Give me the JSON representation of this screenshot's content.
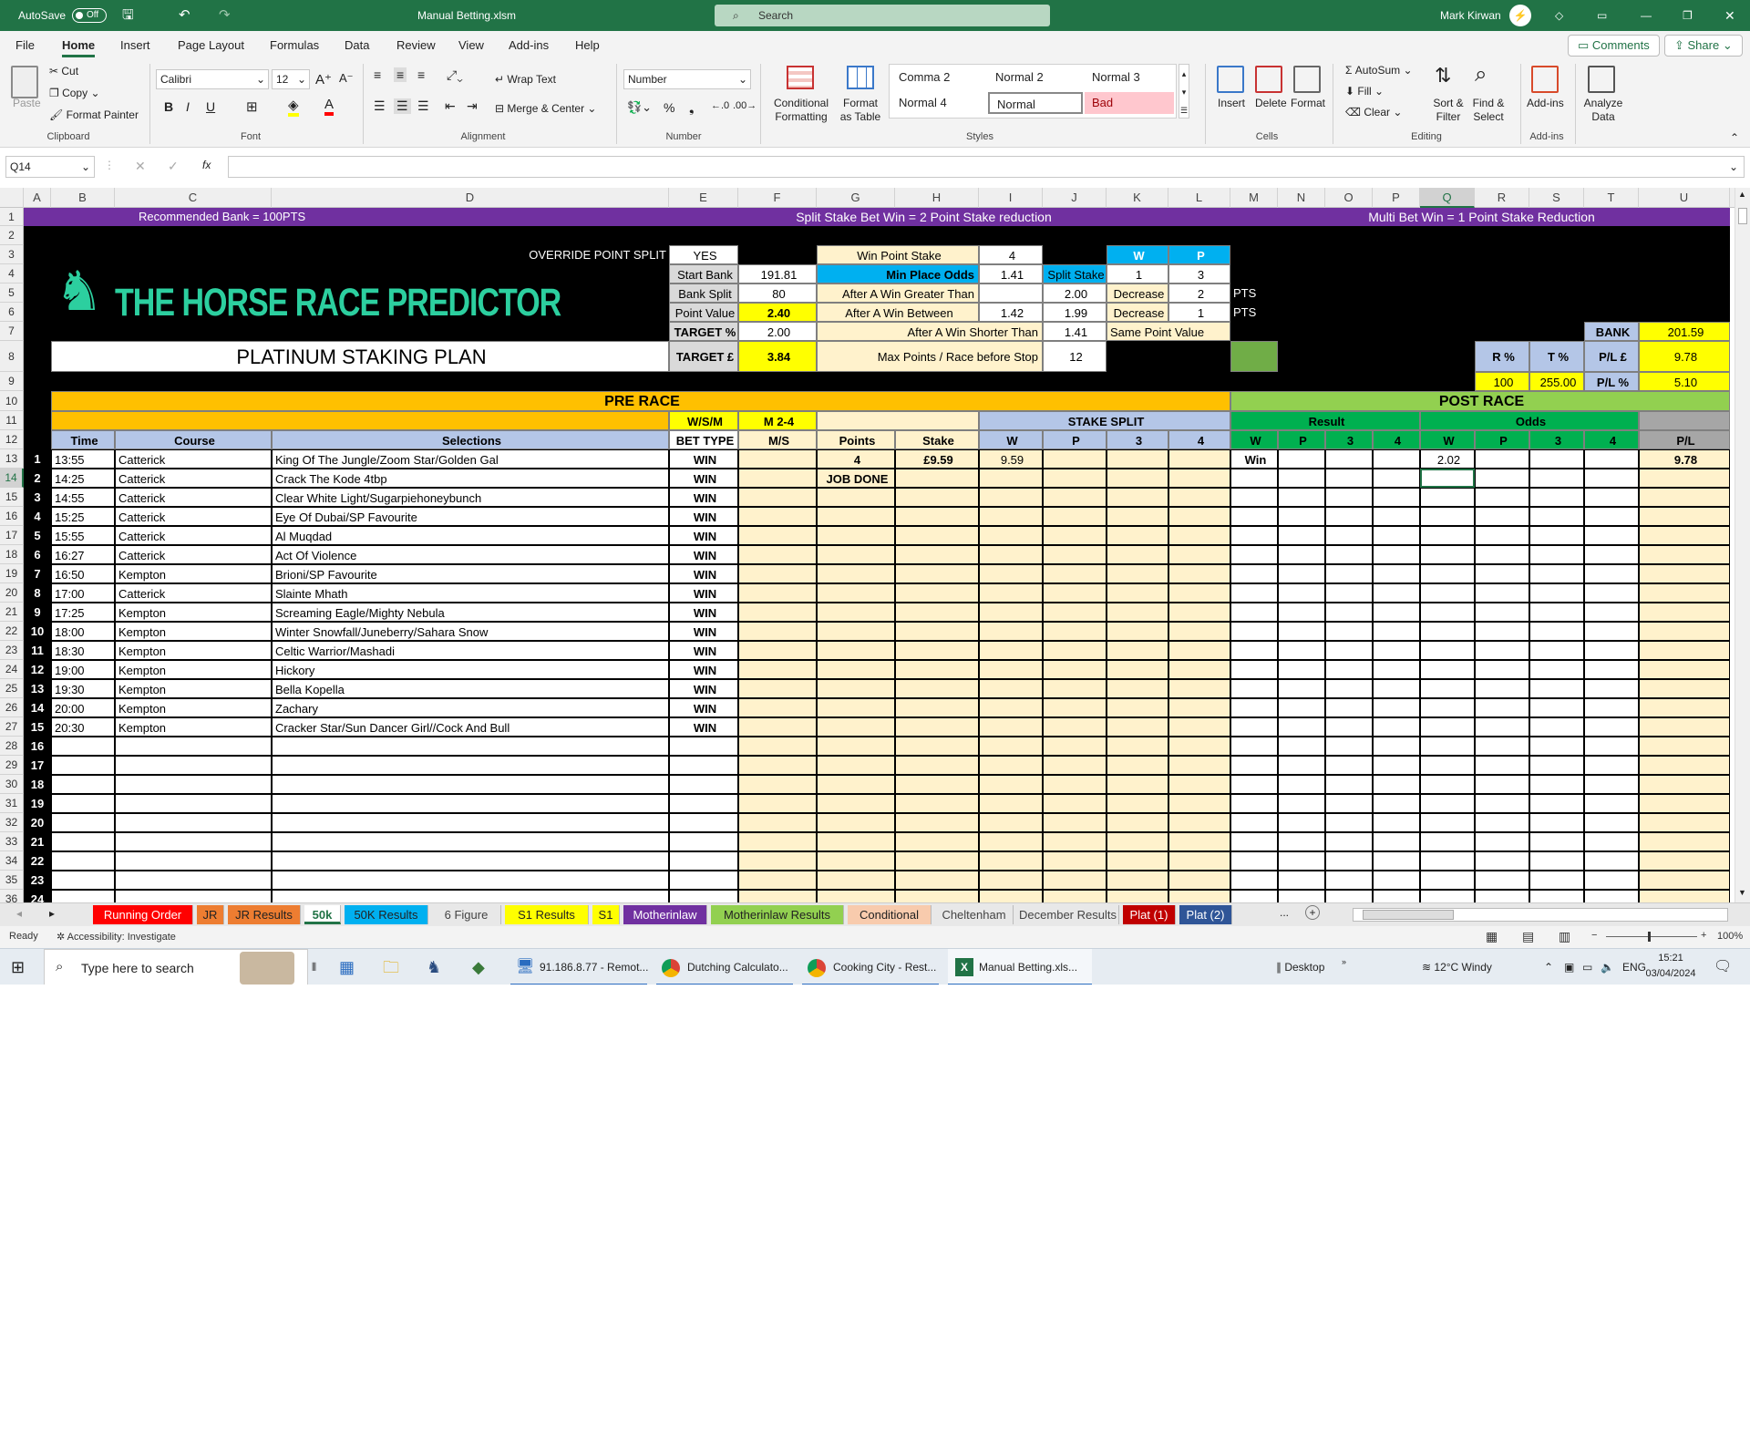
{
  "titlebar": {
    "autosave": "AutoSave",
    "toggle": "Off",
    "file": "Manual Betting.xlsm",
    "search": "Search",
    "user": "Mark Kirwan"
  },
  "menu": {
    "items": [
      "File",
      "Home",
      "Insert",
      "Page Layout",
      "Formulas",
      "Data",
      "Review",
      "View",
      "Add-ins",
      "Help"
    ],
    "comments": "Comments",
    "share": "Share"
  },
  "ribbon": {
    "clipboard": {
      "paste": "Paste",
      "cut": "Cut",
      "copy": "Copy",
      "painter": "Format Painter",
      "label": "Clipboard"
    },
    "font": {
      "name": "Calibri",
      "size": "12",
      "label": "Font",
      "bold": "B",
      "italic": "I",
      "underline": "U"
    },
    "alignment": {
      "wrap": "Wrap Text",
      "merge": "Merge & Center",
      "label": "Alignment"
    },
    "number": {
      "format": "Number",
      "label": "Number"
    },
    "styles": {
      "cond": "Conditional Formatting",
      "table": "Format as Table",
      "cells": [
        "Comma 2",
        "Normal 2",
        "Normal 3",
        "Normal 4",
        "Normal",
        "Bad"
      ],
      "label": "Styles"
    },
    "cells": {
      "insert": "Insert",
      "delete": "Delete",
      "format": "Format",
      "label": "Cells"
    },
    "editing": {
      "autosum": "AutoSum",
      "fill": "Fill",
      "clear": "Clear",
      "sort": "Sort & Filter",
      "find": "Find & Select",
      "label": "Editing"
    },
    "addins": {
      "addins": "Add-ins",
      "analyze": "Analyze Data",
      "label": "Add-ins"
    }
  },
  "formula": {
    "namebox": "Q14",
    "fx": "fx"
  },
  "sheet": {
    "col_letters": [
      "A",
      "B",
      "C",
      "D",
      "E",
      "F",
      "G",
      "H",
      "I",
      "J",
      "K",
      "L",
      "M",
      "N",
      "O",
      "P",
      "Q",
      "R",
      "S",
      "T",
      "U"
    ],
    "banner": {
      "left": "Recommended Bank = 100PTS",
      "mid": "Split Stake Bet Win = 2 Point Stake reduction",
      "right": "Multi Bet Win = 1 Point  Stake Reduction"
    },
    "logo": "THE HORSE RACE PREDICTOR",
    "plan": "PLATINUM STAKING PLAN",
    "params": {
      "override_lbl": "OVERRIDE POINT SPLIT",
      "override_val": "YES",
      "start_bank_lbl": "Start Bank",
      "start_bank": "191.81",
      "bank_split_lbl": "Bank Split",
      "bank_split": "80",
      "point_value_lbl": "Point Value",
      "point_value": "2.40",
      "target_pct_lbl": "TARGET %",
      "target_pct": "2.00",
      "target_gbp_lbl": "TARGET £",
      "target_gbp": "3.84",
      "win_point_stake_lbl": "Win Point Stake",
      "win_point_stake": "4",
      "min_place_lbl": "Min Place Odds",
      "min_place": "1.41",
      "after_greater_lbl": "After A Win Greater Than",
      "after_greater": "2.00",
      "after_between_lbl": "After A Win Between",
      "after_between_a": "1.42",
      "after_between_b": "1.99",
      "after_shorter_lbl": "After A Win Shorter Than",
      "after_shorter": "1.41",
      "max_points_lbl": "Max Points / Race before Stop",
      "max_points": "12",
      "split_stake_lbl": "Split Stake",
      "w_hdr": "W",
      "p_hdr": "P",
      "split_w": "1",
      "split_p": "3",
      "decrease1": "Decrease",
      "decrease1_val": "2",
      "decrease2": "Decrease",
      "decrease2_val": "1",
      "same_point": "Same Point Value",
      "pts1": "PTS",
      "pts2": "PTS",
      "bank_lbl": "BANK",
      "bank": "201.59",
      "r_pct_lbl": "R %",
      "t_pct_lbl": "T %",
      "pl_gbp_lbl": "P/L £",
      "pl_gbp": "9.78",
      "r_pct": "100",
      "t_pct": "255.00",
      "pl_pct_lbl": "P/L %",
      "pl_pct": "5.10"
    },
    "headers": {
      "pre_race": "PRE RACE",
      "post_race": "POST RACE",
      "wsm": "W/S/M",
      "m24": "M 2-4",
      "stake_split": "STAKE SPLIT",
      "result": "Result",
      "odds": "Odds",
      "time": "Time",
      "course": "Course",
      "selections": "Selections",
      "bet_type": "BET TYPE",
      "ms": "M/S",
      "points": "Points",
      "stake": "Stake",
      "w": "W",
      "p": "P",
      "c3": "3",
      "c4": "4",
      "pl": "P/L"
    },
    "rows": [
      {
        "n": "1",
        "time": "13:55",
        "course": "Catterick",
        "sel": "King Of The Jungle/Zoom Star/Golden Gal",
        "bet": "WIN",
        "points": "4",
        "stake": "£9.59",
        "sw": "9.59",
        "res": "Win",
        "odds_w": "2.02",
        "pl": "9.78"
      },
      {
        "n": "2",
        "time": "14:25",
        "course": "Catterick",
        "sel": "Crack The Kode 4tbp",
        "bet": "WIN",
        "points": "JOB DONE"
      },
      {
        "n": "3",
        "time": "14:55",
        "course": "Catterick",
        "sel": "Clear White Light/Sugarpiehoneybunch",
        "bet": "WIN"
      },
      {
        "n": "4",
        "time": "15:25",
        "course": "Catterick",
        "sel": "Eye Of Dubai/SP Favourite",
        "bet": "WIN"
      },
      {
        "n": "5",
        "time": "15:55",
        "course": "Catterick",
        "sel": "Al Muqdad",
        "bet": "WIN"
      },
      {
        "n": "6",
        "time": "16:27",
        "course": "Catterick",
        "sel": "Act Of Violence",
        "bet": "WIN"
      },
      {
        "n": "7",
        "time": "16:50",
        "course": "Kempton",
        "sel": "Brioni/SP Favourite",
        "bet": "WIN"
      },
      {
        "n": "8",
        "time": "17:00",
        "course": "Catterick",
        "sel": "Slainte Mhath",
        "bet": "WIN"
      },
      {
        "n": "9",
        "time": "17:25",
        "course": "Kempton",
        "sel": "Screaming Eagle/Mighty Nebula",
        "bet": "WIN"
      },
      {
        "n": "10",
        "time": "18:00",
        "course": "Kempton",
        "sel": "Winter Snowfall/Juneberry/Sahara Snow",
        "bet": "WIN"
      },
      {
        "n": "11",
        "time": "18:30",
        "course": "Kempton",
        "sel": "Celtic Warrior/Mashadi",
        "bet": "WIN"
      },
      {
        "n": "12",
        "time": "19:00",
        "course": "Kempton",
        "sel": "Hickory",
        "bet": "WIN"
      },
      {
        "n": "13",
        "time": "19:30",
        "course": "Kempton",
        "sel": "Bella Kopella",
        "bet": "WIN"
      },
      {
        "n": "14",
        "time": "20:00",
        "course": "Kempton",
        "sel": "Zachary",
        "bet": "WIN"
      },
      {
        "n": "15",
        "time": "20:30",
        "course": "Kempton",
        "sel": "Cracker Star/Sun Dancer Girl//Cock And Bull",
        "bet": "WIN"
      },
      {
        "n": "16"
      },
      {
        "n": "17"
      },
      {
        "n": "18"
      },
      {
        "n": "19"
      },
      {
        "n": "20"
      },
      {
        "n": "21"
      },
      {
        "n": "22"
      },
      {
        "n": "23"
      },
      {
        "n": "24"
      }
    ]
  },
  "tabs": [
    {
      "label": "Running Order",
      "bg": "#ff0000",
      "fg": "#ffffff"
    },
    {
      "label": "JR",
      "bg": "#ed7d31",
      "fg": "#222222"
    },
    {
      "label": "JR Results",
      "bg": "#ed7d31",
      "fg": "#222222"
    },
    {
      "label": "50k",
      "bg": "#ffffff",
      "fg": "#217346"
    },
    {
      "label": "50K Results",
      "bg": "#00b0f0",
      "fg": "#222222"
    },
    {
      "label": "6 Figure",
      "bg": "#e8e8e8",
      "fg": "#444444"
    },
    {
      "label": "S1 Results",
      "bg": "#ffff00",
      "fg": "#222222"
    },
    {
      "label": "S1",
      "bg": "#ffff00",
      "fg": "#222222"
    },
    {
      "label": "Motherinlaw",
      "bg": "#7030a0",
      "fg": "#ffffff"
    },
    {
      "label": "Motherinlaw Results",
      "bg": "#92d050",
      "fg": "#222222"
    },
    {
      "label": "Conditional",
      "bg": "#f8cbad",
      "fg": "#222222"
    },
    {
      "label": "Cheltenham",
      "bg": "#e8e8e8",
      "fg": "#444444"
    },
    {
      "label": "December Results",
      "bg": "#e8e8e8",
      "fg": "#444444"
    },
    {
      "label": "Plat (1)",
      "bg": "#c00000",
      "fg": "#ffffff"
    },
    {
      "label": "Plat (2)",
      "bg": "#2f5597",
      "fg": "#ffffff"
    }
  ],
  "tabs_more": "...",
  "status": {
    "ready": "Ready",
    "accessibility": "Accessibility: Investigate",
    "zoom": "100%"
  },
  "taskbar": {
    "search": "Type here to search",
    "items": [
      "91.186.8.77 - Remot...",
      "Dutching Calculato...",
      "Cooking City - Rest...",
      "Manual Betting.xls..."
    ],
    "desktop": "Desktop",
    "weather": "12°C  Windy",
    "lang": "ENG",
    "time": "15:21",
    "date": "03/04/2024"
  }
}
